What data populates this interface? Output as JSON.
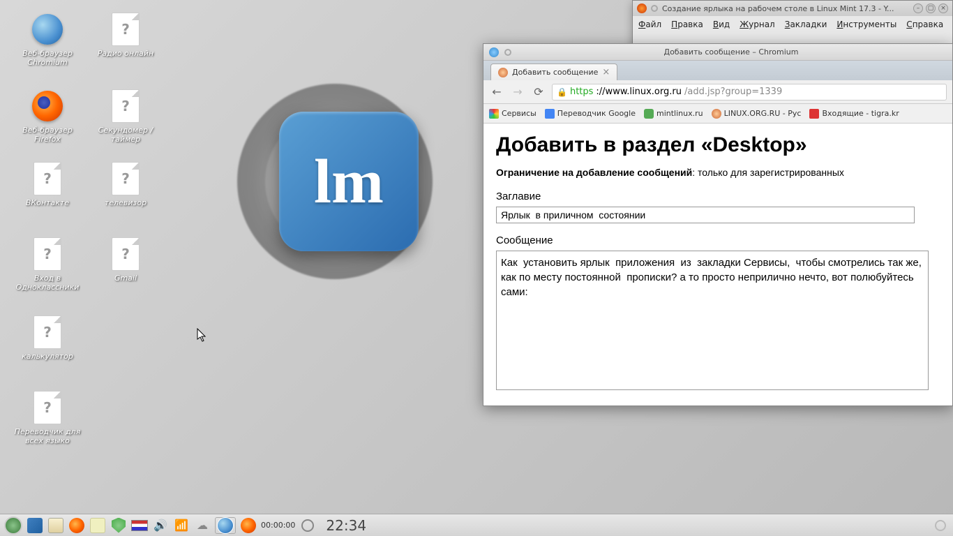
{
  "desktop_icons": {
    "chromium": "Веб-браузер Chromium",
    "firefox": "Веб-браузер Firefox",
    "vkontakte": "ВКонтакте",
    "odnoklassniki": "Вход в Одноклассники",
    "calculator": "калькулятор",
    "translator": "Переводчик для всех языко",
    "radio": "Радио онлайн",
    "stopwatch": "Секундомер / таймер",
    "tv": "телевизор",
    "gmail": "Gmail"
  },
  "firefox_window": {
    "title": "Создание ярлыка на рабочем столе в Linux Mint 17.3 - Y...",
    "menu": {
      "file": "Файл",
      "edit": "Правка",
      "view": "Вид",
      "journal": "Журнал",
      "bookmarks": "Закладки",
      "tools": "Инструменты",
      "help": "Справка"
    }
  },
  "chrome_window": {
    "title": "Добавить сообщение – Chromium",
    "tab_label": "Добавить сообщение",
    "url_proto": "https",
    "url_host": "://www.linux.org.ru",
    "url_path": "/add.jsp?group=1339",
    "bookmarks": {
      "services": "Сервисы",
      "translator": "Переводчик Google",
      "mintlinux": "mintlinux.ru",
      "linuxorg": "LINUX.ORG.RU - Рус",
      "inbox": "Входящие - tigra.kr"
    },
    "page": {
      "heading": "Добавить в раздел «Desktop»",
      "restriction_label": "Ограничение на добавление сообщений",
      "restriction_text": ": только для зарегистрированных",
      "title_label": "Заглавие",
      "title_value": "Ярлык  в приличном  состоянии",
      "message_label": "Сообщение",
      "message_value": "Как  установить ярлык  приложения  из  закладки Сервисы,  чтобы смотрелись так же, как по месту постоянной  прописки? а то просто неприлично нечто, вот полюбуйтесь сами:"
    }
  },
  "taskbar": {
    "timer": "00:00:00",
    "clock": "22:34"
  }
}
